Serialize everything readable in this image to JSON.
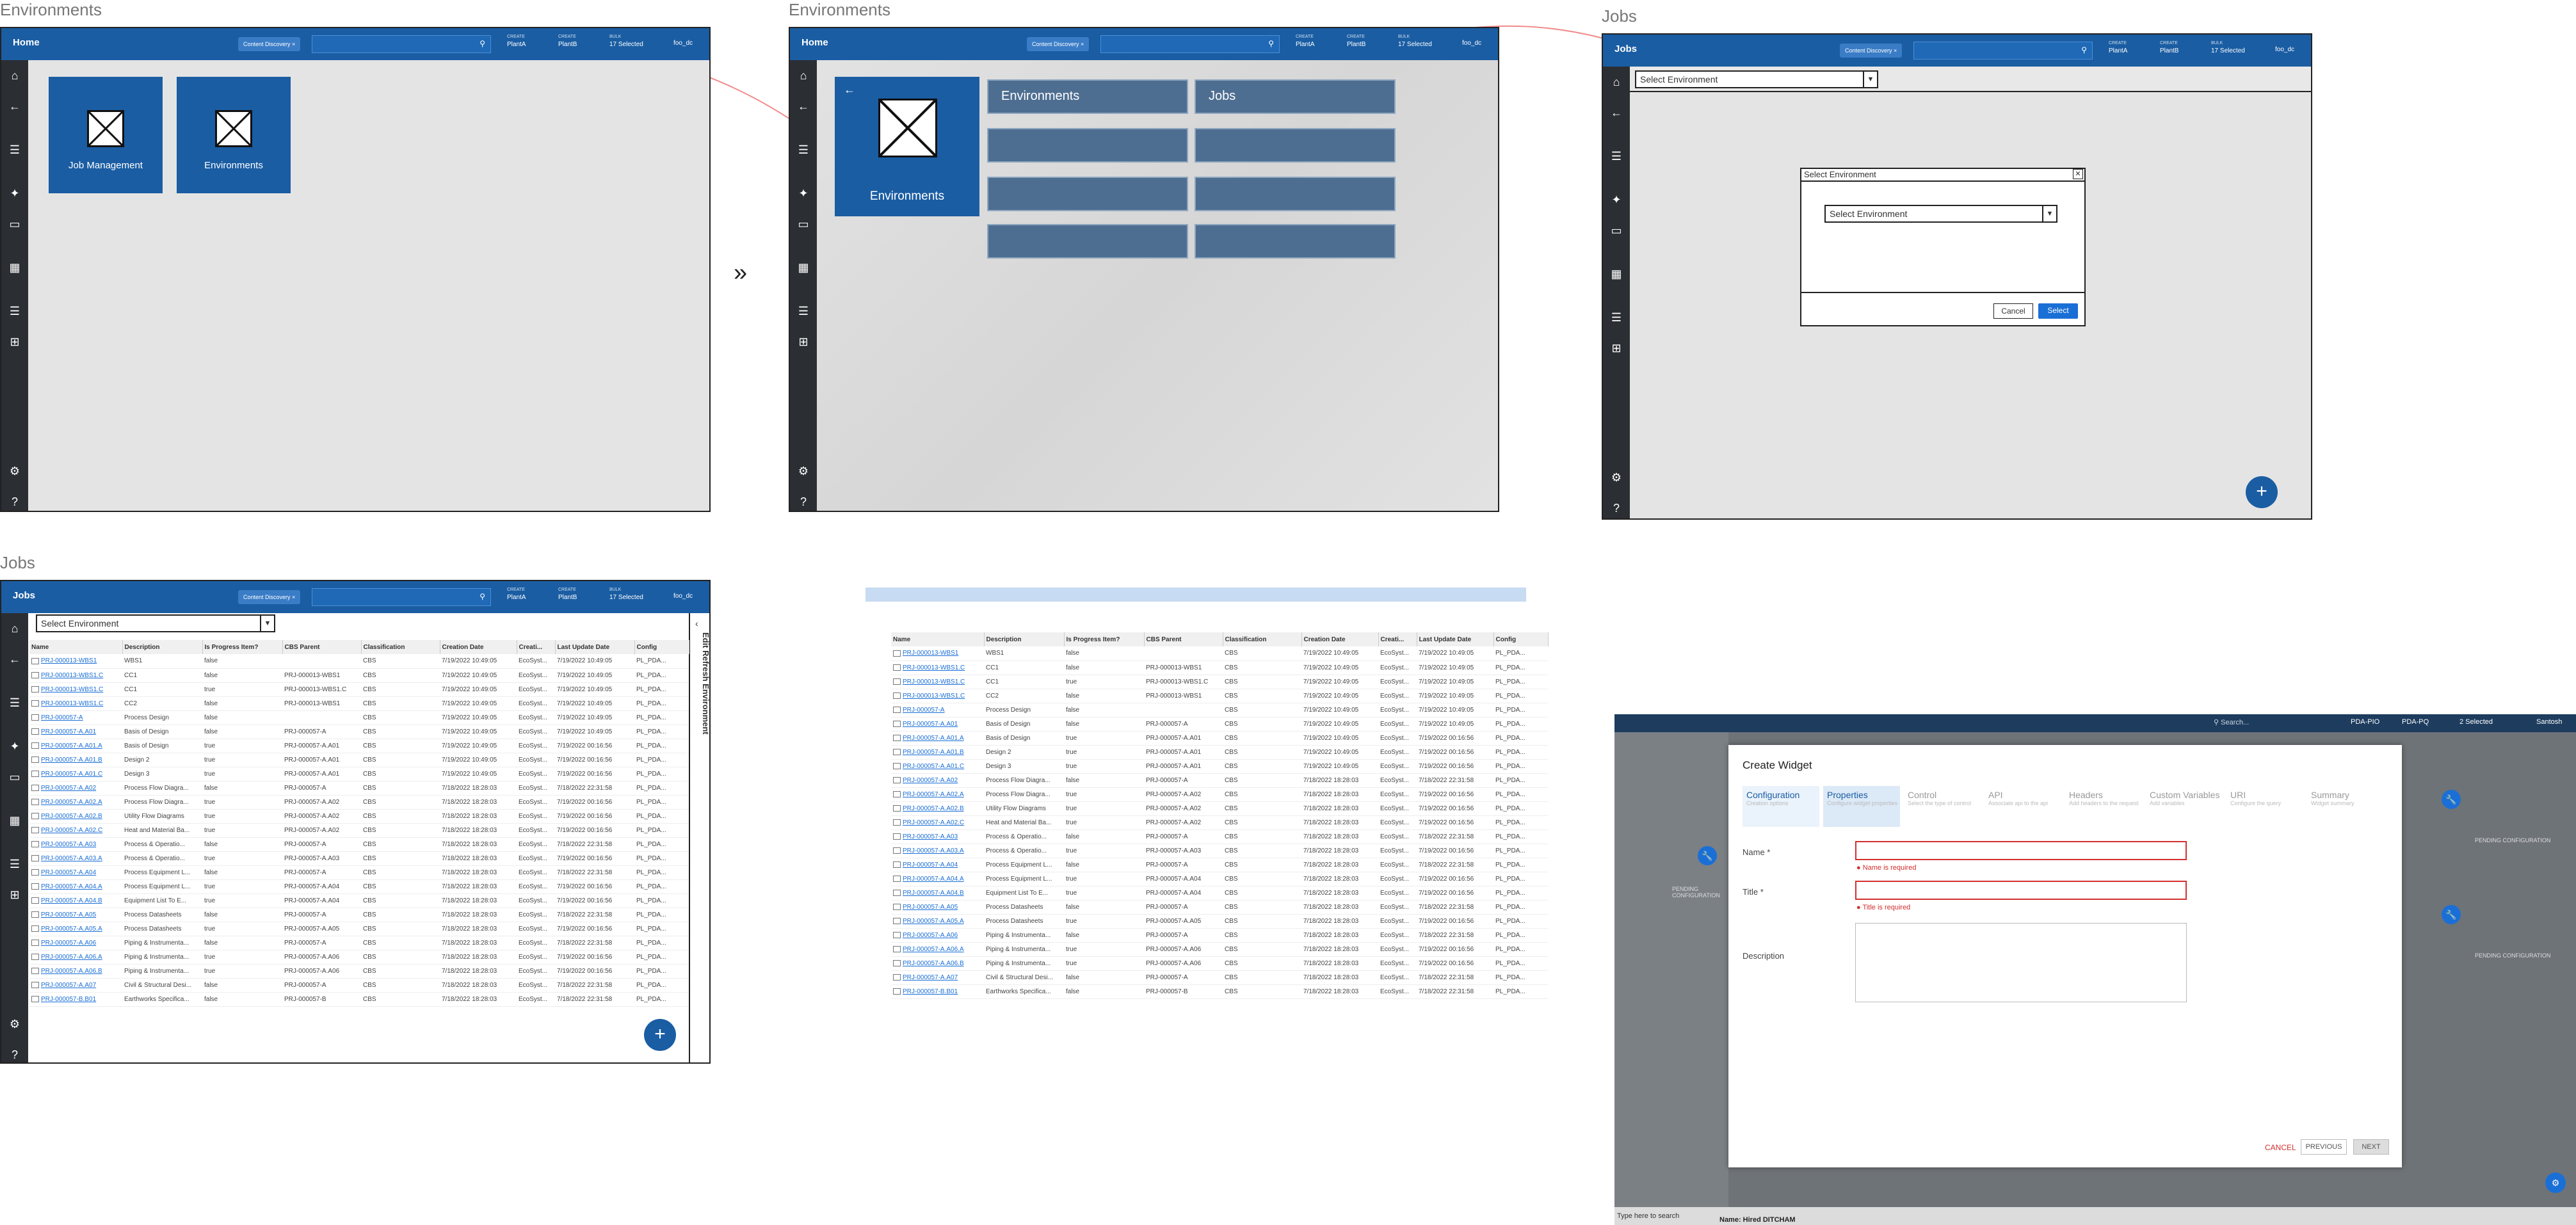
{
  "captions": {
    "environments_1": "Environments",
    "environments_2": "Environments",
    "jobs_1": "Jobs",
    "jobs_2": "Jobs"
  },
  "transition_arrow": "»",
  "topbar": {
    "home": "Home",
    "jobs": "Jobs",
    "chip": "Content Discovery",
    "chip_close": "×",
    "chip_more": "•",
    "btn1": {
      "small": "CREATE",
      "label": "PlantA"
    },
    "btn2": {
      "small": "CREATE",
      "label": "PlantB"
    },
    "btn3": {
      "small": "BULK",
      "label": "17 Selected"
    },
    "user": "foo_dc"
  },
  "screen1": {
    "tiles": [
      "Job Management",
      "Environments"
    ]
  },
  "screen2": {
    "tile": "Environments",
    "buttons": [
      "Environments",
      "Jobs"
    ]
  },
  "screen3": {
    "select_label": "Select Environment",
    "dialog_title": "Select Environment",
    "dialog_close": "✕",
    "dialog_select": "Select Environment",
    "cancel": "Cancel",
    "select": "Select",
    "fab": "+"
  },
  "table": {
    "side_panel": "Edit Refresh Environment",
    "headers": [
      "Name",
      "Description",
      "Is Progress Item?",
      "CBS Parent",
      "Classification",
      "Creation Date",
      "Creati...",
      "Last Update Date",
      "Config"
    ],
    "rows": [
      [
        "PRJ-000013-WBS1",
        "WBS1",
        "false",
        "",
        "CBS",
        "7/19/2022 10:49:05",
        "EcoSyst...",
        "7/19/2022 10:49:05",
        "PL_PDA..."
      ],
      [
        "PRJ-000013-WBS1.C",
        "CC1",
        "false",
        "PRJ-000013-WBS1",
        "CBS",
        "7/19/2022 10:49:05",
        "EcoSyst...",
        "7/19/2022 10:49:05",
        "PL_PDA..."
      ],
      [
        "PRJ-000013-WBS1.C",
        "CC1",
        "true",
        "PRJ-000013-WBS1.C",
        "CBS",
        "7/19/2022 10:49:05",
        "EcoSyst...",
        "7/19/2022 10:49:05",
        "PL_PDA..."
      ],
      [
        "PRJ-000013-WBS1.C",
        "CC2",
        "false",
        "PRJ-000013-WBS1",
        "CBS",
        "7/19/2022 10:49:05",
        "EcoSyst...",
        "7/19/2022 10:49:05",
        "PL_PDA..."
      ],
      [
        "PRJ-000057-A",
        "Process Design",
        "false",
        "",
        "CBS",
        "7/19/2022 10:49:05",
        "EcoSyst...",
        "7/19/2022 10:49:05",
        "PL_PDA..."
      ],
      [
        "PRJ-000057-A.A01",
        "Basis of Design",
        "false",
        "PRJ-000057-A",
        "CBS",
        "7/19/2022 10:49:05",
        "EcoSyst...",
        "7/19/2022 10:49:05",
        "PL_PDA..."
      ],
      [
        "PRJ-000057-A.A01.A",
        "Basis of Design",
        "true",
        "PRJ-000057-A.A01",
        "CBS",
        "7/19/2022 10:49:05",
        "EcoSyst...",
        "7/19/2022 00:16:56",
        "PL_PDA..."
      ],
      [
        "PRJ-000057-A.A01.B",
        "Design 2",
        "true",
        "PRJ-000057-A.A01",
        "CBS",
        "7/19/2022 10:49:05",
        "EcoSyst...",
        "7/19/2022 00:16:56",
        "PL_PDA..."
      ],
      [
        "PRJ-000057-A.A01.C",
        "Design 3",
        "true",
        "PRJ-000057-A.A01",
        "CBS",
        "7/19/2022 10:49:05",
        "EcoSyst...",
        "7/19/2022 00:16:56",
        "PL_PDA..."
      ],
      [
        "PRJ-000057-A.A02",
        "Process Flow Diagra...",
        "false",
        "PRJ-000057-A",
        "CBS",
        "7/18/2022 18:28:03",
        "EcoSyst...",
        "7/18/2022 22:31:58",
        "PL_PDA..."
      ],
      [
        "PRJ-000057-A.A02.A",
        "Process Flow Diagra...",
        "true",
        "PRJ-000057-A.A02",
        "CBS",
        "7/18/2022 18:28:03",
        "EcoSyst...",
        "7/19/2022 00:16:56",
        "PL_PDA..."
      ],
      [
        "PRJ-000057-A.A02.B",
        "Utility Flow Diagrams",
        "true",
        "PRJ-000057-A.A02",
        "CBS",
        "7/18/2022 18:28:03",
        "EcoSyst...",
        "7/19/2022 00:16:56",
        "PL_PDA..."
      ],
      [
        "PRJ-000057-A.A02.C",
        "Heat and Material Ba...",
        "true",
        "PRJ-000057-A.A02",
        "CBS",
        "7/18/2022 18:28:03",
        "EcoSyst...",
        "7/19/2022 00:16:56",
        "PL_PDA..."
      ],
      [
        "PRJ-000057-A.A03",
        "Process & Operatio...",
        "false",
        "PRJ-000057-A",
        "CBS",
        "7/18/2022 18:28:03",
        "EcoSyst...",
        "7/18/2022 22:31:58",
        "PL_PDA..."
      ],
      [
        "PRJ-000057-A.A03.A",
        "Process & Operatio...",
        "true",
        "PRJ-000057-A.A03",
        "CBS",
        "7/18/2022 18:28:03",
        "EcoSyst...",
        "7/19/2022 00:16:56",
        "PL_PDA..."
      ],
      [
        "PRJ-000057-A.A04",
        "Process Equipment L...",
        "false",
        "PRJ-000057-A",
        "CBS",
        "7/18/2022 18:28:03",
        "EcoSyst...",
        "7/18/2022 22:31:58",
        "PL_PDA..."
      ],
      [
        "PRJ-000057-A.A04.A",
        "Process Equipment L...",
        "true",
        "PRJ-000057-A.A04",
        "CBS",
        "7/18/2022 18:28:03",
        "EcoSyst...",
        "7/19/2022 00:16:56",
        "PL_PDA..."
      ],
      [
        "PRJ-000057-A.A04.B",
        "Equipment List To E...",
        "true",
        "PRJ-000057-A.A04",
        "CBS",
        "7/18/2022 18:28:03",
        "EcoSyst...",
        "7/19/2022 00:16:56",
        "PL_PDA..."
      ],
      [
        "PRJ-000057-A.A05",
        "Process Datasheets",
        "false",
        "PRJ-000057-A",
        "CBS",
        "7/18/2022 18:28:03",
        "EcoSyst...",
        "7/18/2022 22:31:58",
        "PL_PDA..."
      ],
      [
        "PRJ-000057-A.A05.A",
        "Process Datasheets",
        "true",
        "PRJ-000057-A.A05",
        "CBS",
        "7/18/2022 18:28:03",
        "EcoSyst...",
        "7/19/2022 00:16:56",
        "PL_PDA..."
      ],
      [
        "PRJ-000057-A.A06",
        "Piping & Instrumenta...",
        "false",
        "PRJ-000057-A",
        "CBS",
        "7/18/2022 18:28:03",
        "EcoSyst...",
        "7/18/2022 22:31:58",
        "PL_PDA..."
      ],
      [
        "PRJ-000057-A.A06.A",
        "Piping & Instrumenta...",
        "true",
        "PRJ-000057-A.A06",
        "CBS",
        "7/18/2022 18:28:03",
        "EcoSyst...",
        "7/19/2022 00:16:56",
        "PL_PDA..."
      ],
      [
        "PRJ-000057-A.A06.B",
        "Piping & Instrumenta...",
        "true",
        "PRJ-000057-A.A06",
        "CBS",
        "7/18/2022 18:28:03",
        "EcoSyst...",
        "7/19/2022 00:16:56",
        "PL_PDA..."
      ],
      [
        "PRJ-000057-A.A07",
        "Civil & Structural Desi...",
        "false",
        "PRJ-000057-A",
        "CBS",
        "7/18/2022 18:28:03",
        "EcoSyst...",
        "7/18/2022 22:31:58",
        "PL_PDA..."
      ],
      [
        "PRJ-000057-B.B01",
        "Earthworks Specifica...",
        "false",
        "PRJ-000057-B",
        "CBS",
        "7/18/2022 18:28:03",
        "EcoSyst...",
        "7/18/2022 22:31:58",
        "PL_PDA..."
      ]
    ]
  },
  "widget": {
    "search": "Search...",
    "top_btns": [
      "PDA-PIO",
      "PDA-PQ",
      "2 Selected",
      "Santosh"
    ],
    "title": "Create Widget",
    "steps": [
      {
        "label": "Configuration",
        "sub": "Creation options"
      },
      {
        "label": "Properties",
        "sub": "Configure widget properties"
      },
      {
        "label": "Control",
        "sub": "Select the type of control"
      },
      {
        "label": "API",
        "sub": "Associate api to the api"
      },
      {
        "label": "Headers",
        "sub": "Add headers to the request"
      },
      {
        "label": "Custom Variables",
        "sub": "Add variables"
      },
      {
        "label": "URI",
        "sub": "Configure the query"
      },
      {
        "label": "Summary",
        "sub": "Widget summary"
      }
    ],
    "name_label": "Name *",
    "name_err": "Name is required",
    "title_label": "Title *",
    "title_err": "Title is required",
    "desc_label": "Description",
    "cancel": "CANCEL",
    "previous": "PREVIOUS",
    "next": "NEXT",
    "pending": "PENDING CONFIGURATION",
    "footer_search": "Type here to search",
    "footer_name": "Name: Hired DITCHAM"
  },
  "colors": {
    "primary": "#1a5da3",
    "error": "#d32f2f",
    "nav": "#4e6e91"
  }
}
